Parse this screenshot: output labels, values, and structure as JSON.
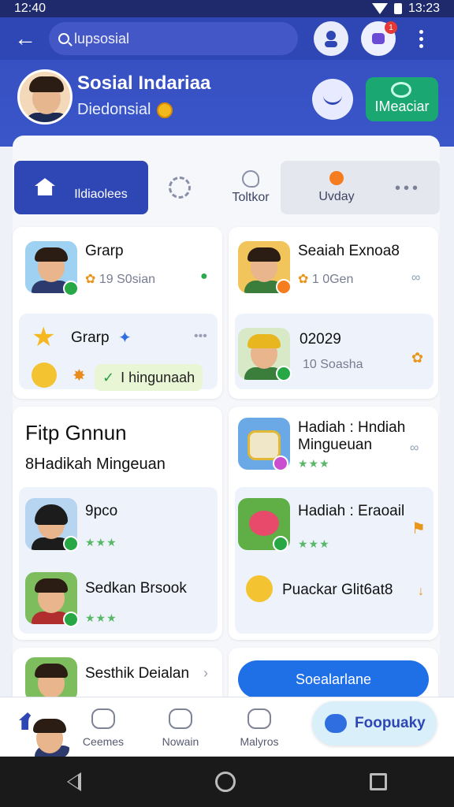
{
  "status": {
    "time": "12:40",
    "time_right": "13:23"
  },
  "appbar": {
    "search_text": "lupsosial"
  },
  "profile": {
    "name": "Sosial Indariaa",
    "subtitle": "Diedonsial",
    "cta_label": "IMeaciar"
  },
  "tabs": [
    {
      "label": "Ildiaolees"
    },
    {
      "label": ""
    },
    {
      "label": "Toltkor"
    },
    {
      "label": "Uvday"
    }
  ],
  "cards": {
    "c1": {
      "title": "Grarp",
      "meta": "19 S0sian",
      "inner_title": "Grarp",
      "chip": "I hingunaah"
    },
    "c2": {
      "title": "Seaiah Exnoa8",
      "meta": "1 0Gen",
      "inner_title": "02029",
      "inner_meta": "10 Soasha"
    },
    "c3": {
      "title": "Fitp Gnnun",
      "subtitle": "8Hadikah Mingeuan",
      "row1_title": "9pco",
      "row2_title": "Sedkan Brsook",
      "stars": "★★★"
    },
    "c4": {
      "title": "Hadiah : Hndiah Mingueuan",
      "row1_title": "Hadiah : Eraoail",
      "row2_title": "Puackar Glit6at8",
      "stars": "★★★"
    },
    "c5": {
      "title": "Sesthik Deialan"
    },
    "c6": {
      "button": "Soealarlane"
    }
  },
  "bottomnav": {
    "items": [
      "Ceemes",
      "Nowain",
      "Malyros"
    ],
    "fab_label": "Foopuaky"
  },
  "colors": {
    "primary": "#2f46b5",
    "accent_green": "#1aa772",
    "blue_button": "#1f6fe6"
  }
}
